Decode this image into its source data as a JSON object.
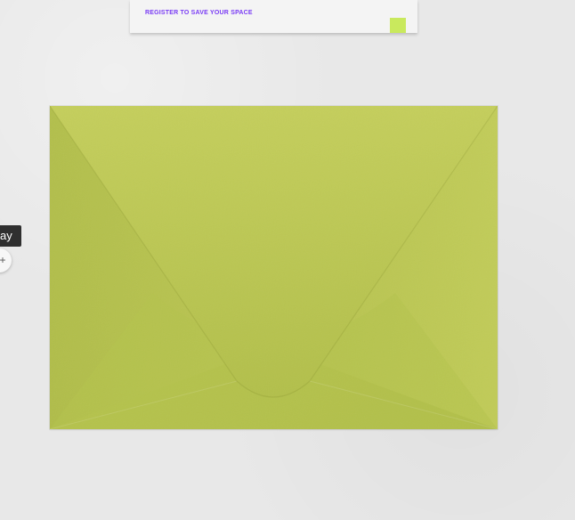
{
  "card": {
    "text": "REGISTER TO SAVE YOUR SPACE"
  },
  "side": {
    "tab_label": "ay"
  },
  "icons": {
    "side_button_icon": "plus-icon"
  },
  "colors": {
    "background": "#e8e8e8",
    "card_background": "#f4f4f4",
    "card_text": "#7a3cf5",
    "swatch": "#c9e95d",
    "envelope": "#b9c54f",
    "side_tab": "#2f2f2f"
  }
}
